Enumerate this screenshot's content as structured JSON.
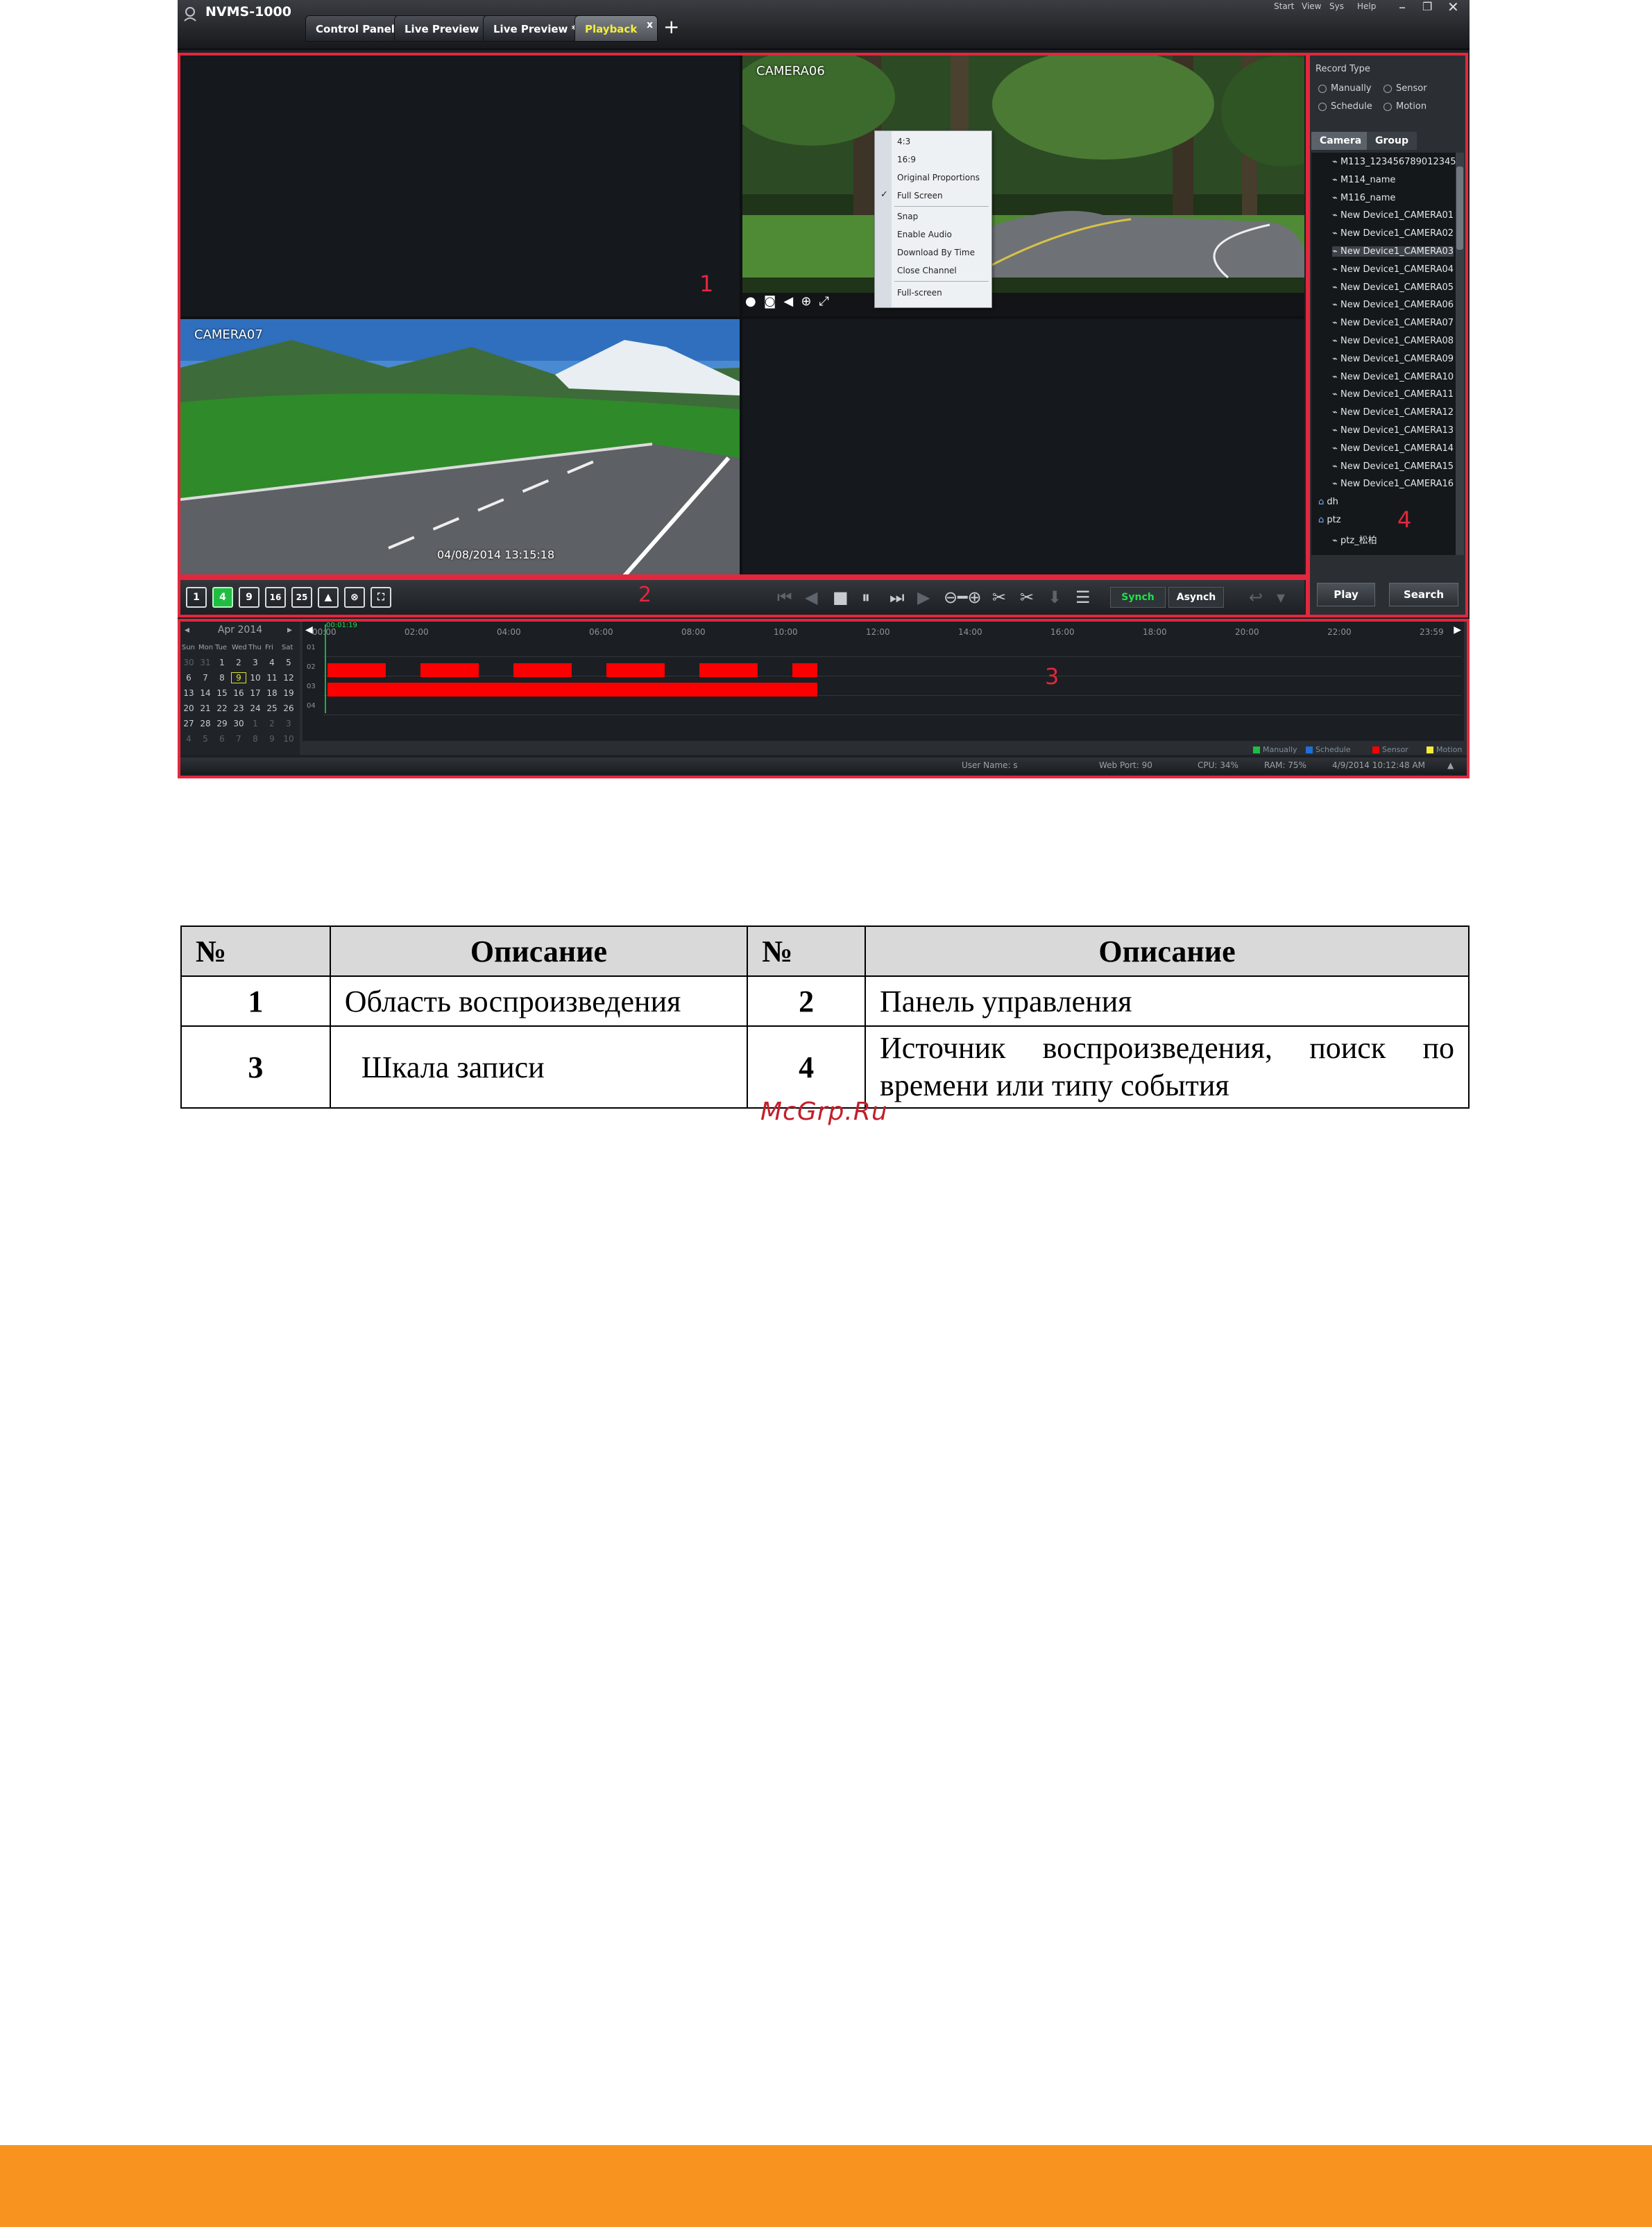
{
  "app": {
    "title": "NVMS-1000",
    "tabs": [
      {
        "label": "Control Panel"
      },
      {
        "label": "Live Preview *"
      },
      {
        "label": "Live Preview *"
      },
      {
        "label": "Playback",
        "active": true
      }
    ],
    "tab_close": "x",
    "tab_add": "+",
    "menu": [
      "Start",
      "View",
      "Sys",
      "Help"
    ],
    "window_buttons": [
      "–",
      "❐",
      "✕"
    ]
  },
  "video": {
    "cameras": [
      {
        "label": "CAMERA06"
      },
      {
        "label": "CAMERA07"
      }
    ],
    "timestamp": "04/08/2014  13:15:18",
    "area_numbers": [
      "1",
      "2",
      "3",
      "4"
    ]
  },
  "context_menu": {
    "items": [
      "4:3",
      "16:9",
      "Original Proportions",
      "Full Screen",
      "Snap",
      "Enable Audio",
      "Download By Time",
      "Close Channel",
      "Full-screen"
    ],
    "checked": "Full Screen"
  },
  "controls": {
    "layout_buttons": [
      "1",
      "4",
      "9",
      "16",
      "25"
    ],
    "sync": "Synch",
    "async": "Asynch"
  },
  "right_panel": {
    "record_type_label": "Record Type",
    "record_types": [
      "Manually",
      "Sensor",
      "Schedule",
      "Motion"
    ],
    "tabs": [
      "Camera",
      "Group"
    ],
    "tree_items": [
      "M113_123456789012345",
      "M114_name",
      "M116_name",
      "New Device1_CAMERA01",
      "New Device1_CAMERA02",
      "New Device1_CAMERA03",
      "New Device1_CAMERA04",
      "New Device1_CAMERA05",
      "New Device1_CAMERA06",
      "New Device1_CAMERA07",
      "New Device1_CAMERA08",
      "New Device1_CAMERA09",
      "New Device1_CAMERA10",
      "New Device1_CAMERA11",
      "New Device1_CAMERA12",
      "New Device1_CAMERA13",
      "New Device1_CAMERA14",
      "New Device1_CAMERA15",
      "New Device1_CAMERA16"
    ],
    "groups": [
      "dh",
      "ptz"
    ],
    "ptz_child": "ptz_松柏",
    "play": "Play",
    "search": "Search"
  },
  "calendar": {
    "title": "Apr 2014",
    "weekdays": [
      "Sun",
      "Mon",
      "Tue",
      "Wed",
      "Thu",
      "Fri",
      "Sat"
    ],
    "weeks": [
      [
        "30",
        "31",
        "1",
        "2",
        "3",
        "4",
        "5"
      ],
      [
        "6",
        "7",
        "8",
        "9",
        "10",
        "11",
        "12"
      ],
      [
        "13",
        "14",
        "15",
        "16",
        "17",
        "18",
        "19"
      ],
      [
        "20",
        "21",
        "22",
        "23",
        "24",
        "25",
        "26"
      ],
      [
        "27",
        "28",
        "29",
        "30",
        "1",
        "2",
        "3"
      ],
      [
        "4",
        "5",
        "6",
        "7",
        "8",
        "9",
        "10"
      ]
    ],
    "today": "9"
  },
  "timeline": {
    "hours": [
      "00:00",
      "02:00",
      "04:00",
      "06:00",
      "08:00",
      "10:00",
      "12:00",
      "14:00",
      "16:00",
      "18:00",
      "20:00",
      "22:00",
      "23:59"
    ],
    "rows": [
      "01",
      "02",
      "03",
      "04"
    ],
    "cursor_time": "00:01:19",
    "legend": [
      {
        "label": "Manually",
        "color": "#1fbe42"
      },
      {
        "label": "Schedule",
        "color": "#1e6fd9"
      },
      {
        "label": "Sensor",
        "color": "#fb0000"
      },
      {
        "label": "Motion",
        "color": "#f4ee3a"
      }
    ]
  },
  "status": {
    "user": "User Name: s",
    "port": "Web Port: 90",
    "cpu": "CPU: 34%",
    "ram": "RAM: 75%",
    "datetime": "4/9/2014 10:12:48 AM"
  },
  "table": {
    "headers": [
      "№",
      "Описание",
      "№",
      "Описание"
    ],
    "rows": [
      [
        "1",
        "Область воспроизведения",
        "2",
        "Панель управления"
      ],
      [
        "3",
        "Шкала записи",
        "4",
        "Источник воспроизведения, поиск по времени или типу события"
      ]
    ]
  },
  "watermark": "McGrp.Ru"
}
